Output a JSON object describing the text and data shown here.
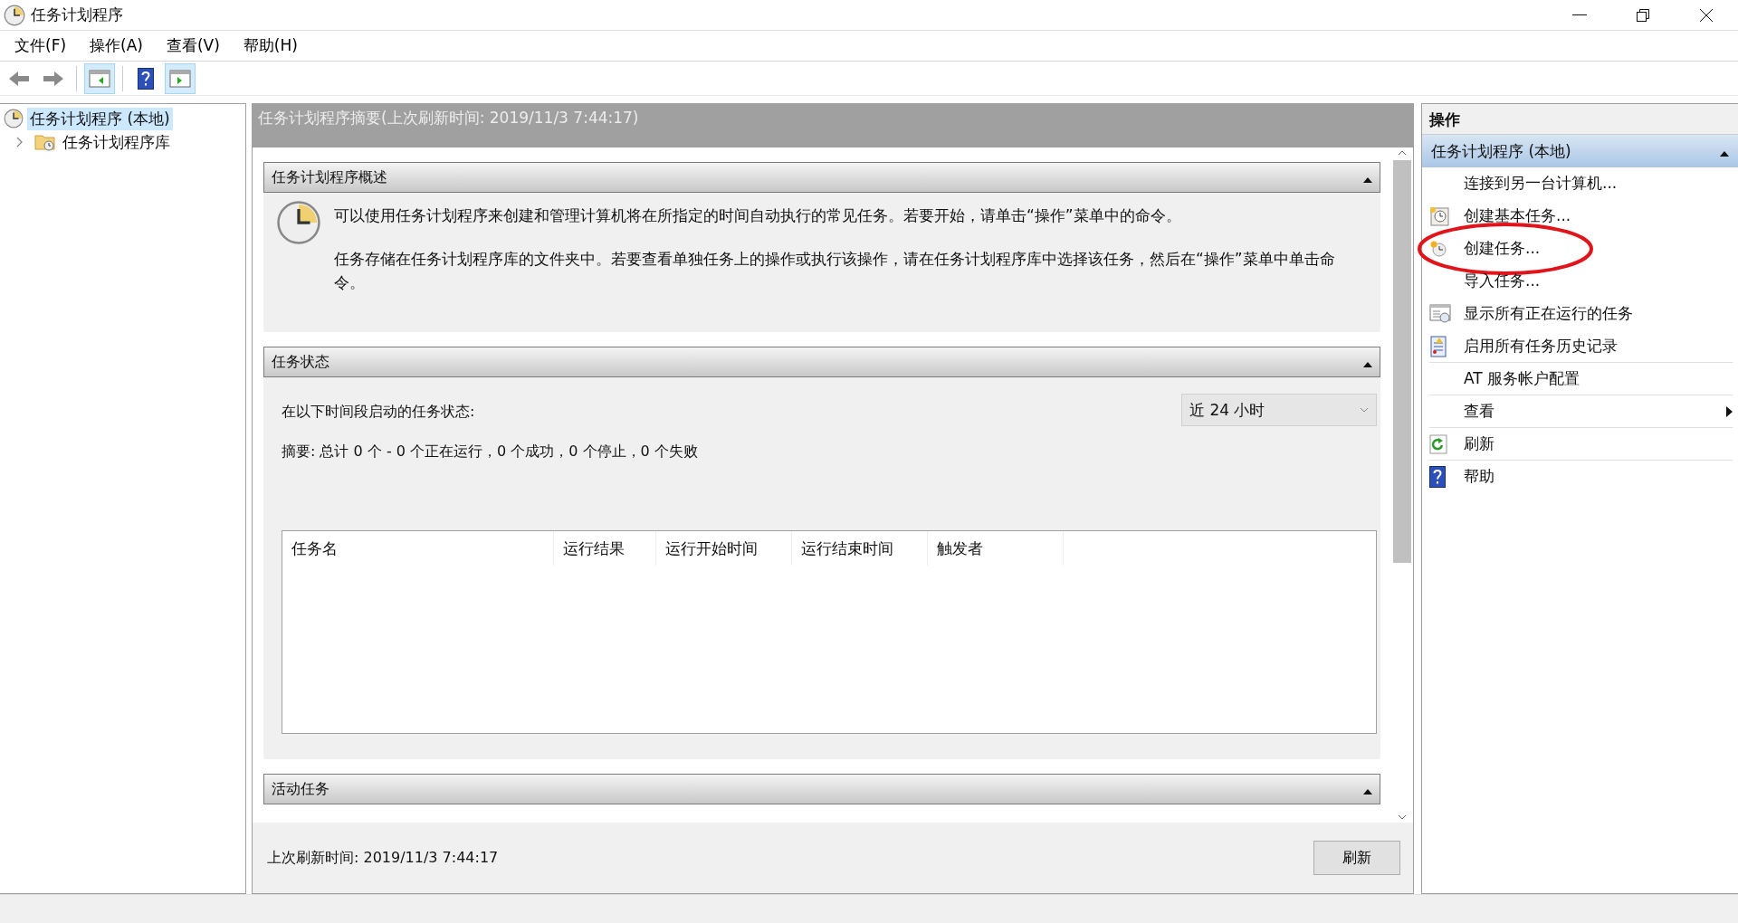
{
  "window": {
    "title": "任务计划程序"
  },
  "menu": [
    "文件(F)",
    "操作(A)",
    "查看(V)",
    "帮助(H)"
  ],
  "toolbar": [
    {
      "kind": "back",
      "pressed": false
    },
    {
      "kind": "forward",
      "pressed": false
    },
    {
      "kind": "tree",
      "pressed": true
    },
    {
      "kind": "help",
      "pressed": false
    },
    {
      "kind": "actions",
      "pressed": true
    }
  ],
  "tree": [
    {
      "label": "任务计划程序 (本地)",
      "selected": true,
      "children": [
        {
          "label": "任务计划程序库",
          "selected": false,
          "expanded": false
        }
      ]
    }
  ],
  "summary": {
    "title": "任务计划程序摘要(上次刷新时间: 2019/11/3 7:44:17)",
    "overview": {
      "title": "任务计划程序概述",
      "expanded": true,
      "paragraphs": [
        "可以使用任务计划程序来创建和管理计算机将在所指定的时间自动执行的常见任务。若要开始，请单击“操作”菜单中的命令。",
        "任务存储在任务计划程序库的文件夹中。若要查看单独任务上的操作或执行该操作，请在任务计划程序库中选择该任务，然后在“操作”菜单中单击命令。"
      ]
    },
    "status": {
      "title": "任务状态",
      "expanded": true,
      "period_label": "在以下时间段启动的任务状态:",
      "period": "近 24 小时",
      "summary": "摘要: 总计 0 个 - 0 个正在运行，0 个成功，0 个停止，0 个失败",
      "columns": [
        "任务名",
        "运行结果",
        "运行开始时间",
        "运行结束时间",
        "触发者"
      ]
    },
    "active": {
      "title": "活动任务",
      "expanded": true
    },
    "footer_text": "上次刷新时间: 2019/11/3 7:44:17",
    "refresh_button": "刷新"
  },
  "actions": {
    "title": "操作",
    "group": {
      "label": "任务计划程序 (本地)",
      "expanded": true
    },
    "items": [
      {
        "label": "连接到另一台计算机...",
        "kind": "plain",
        "divider": false,
        "circled": false
      },
      {
        "label": "创建基本任务...",
        "kind": "wizard",
        "divider": false,
        "circled": false
      },
      {
        "label": "创建任务...",
        "kind": "task",
        "divider": false,
        "circled": true
      },
      {
        "label": "导入任务...",
        "kind": "plain",
        "divider": false,
        "circled": false
      },
      {
        "label": "显示所有正在运行的任务",
        "kind": "running",
        "divider": false,
        "circled": false
      },
      {
        "label": "启用所有任务历史记录",
        "kind": "history",
        "divider": true,
        "circled": false
      },
      {
        "label": "AT 服务帐户配置",
        "kind": "plain",
        "divider": true,
        "circled": false
      },
      {
        "label": "查看",
        "kind": "submenu",
        "divider": true,
        "circled": false
      },
      {
        "label": "刷新",
        "kind": "refresh",
        "divider": true,
        "circled": false
      },
      {
        "label": "帮助",
        "kind": "help",
        "divider": false,
        "circled": false
      }
    ]
  }
}
